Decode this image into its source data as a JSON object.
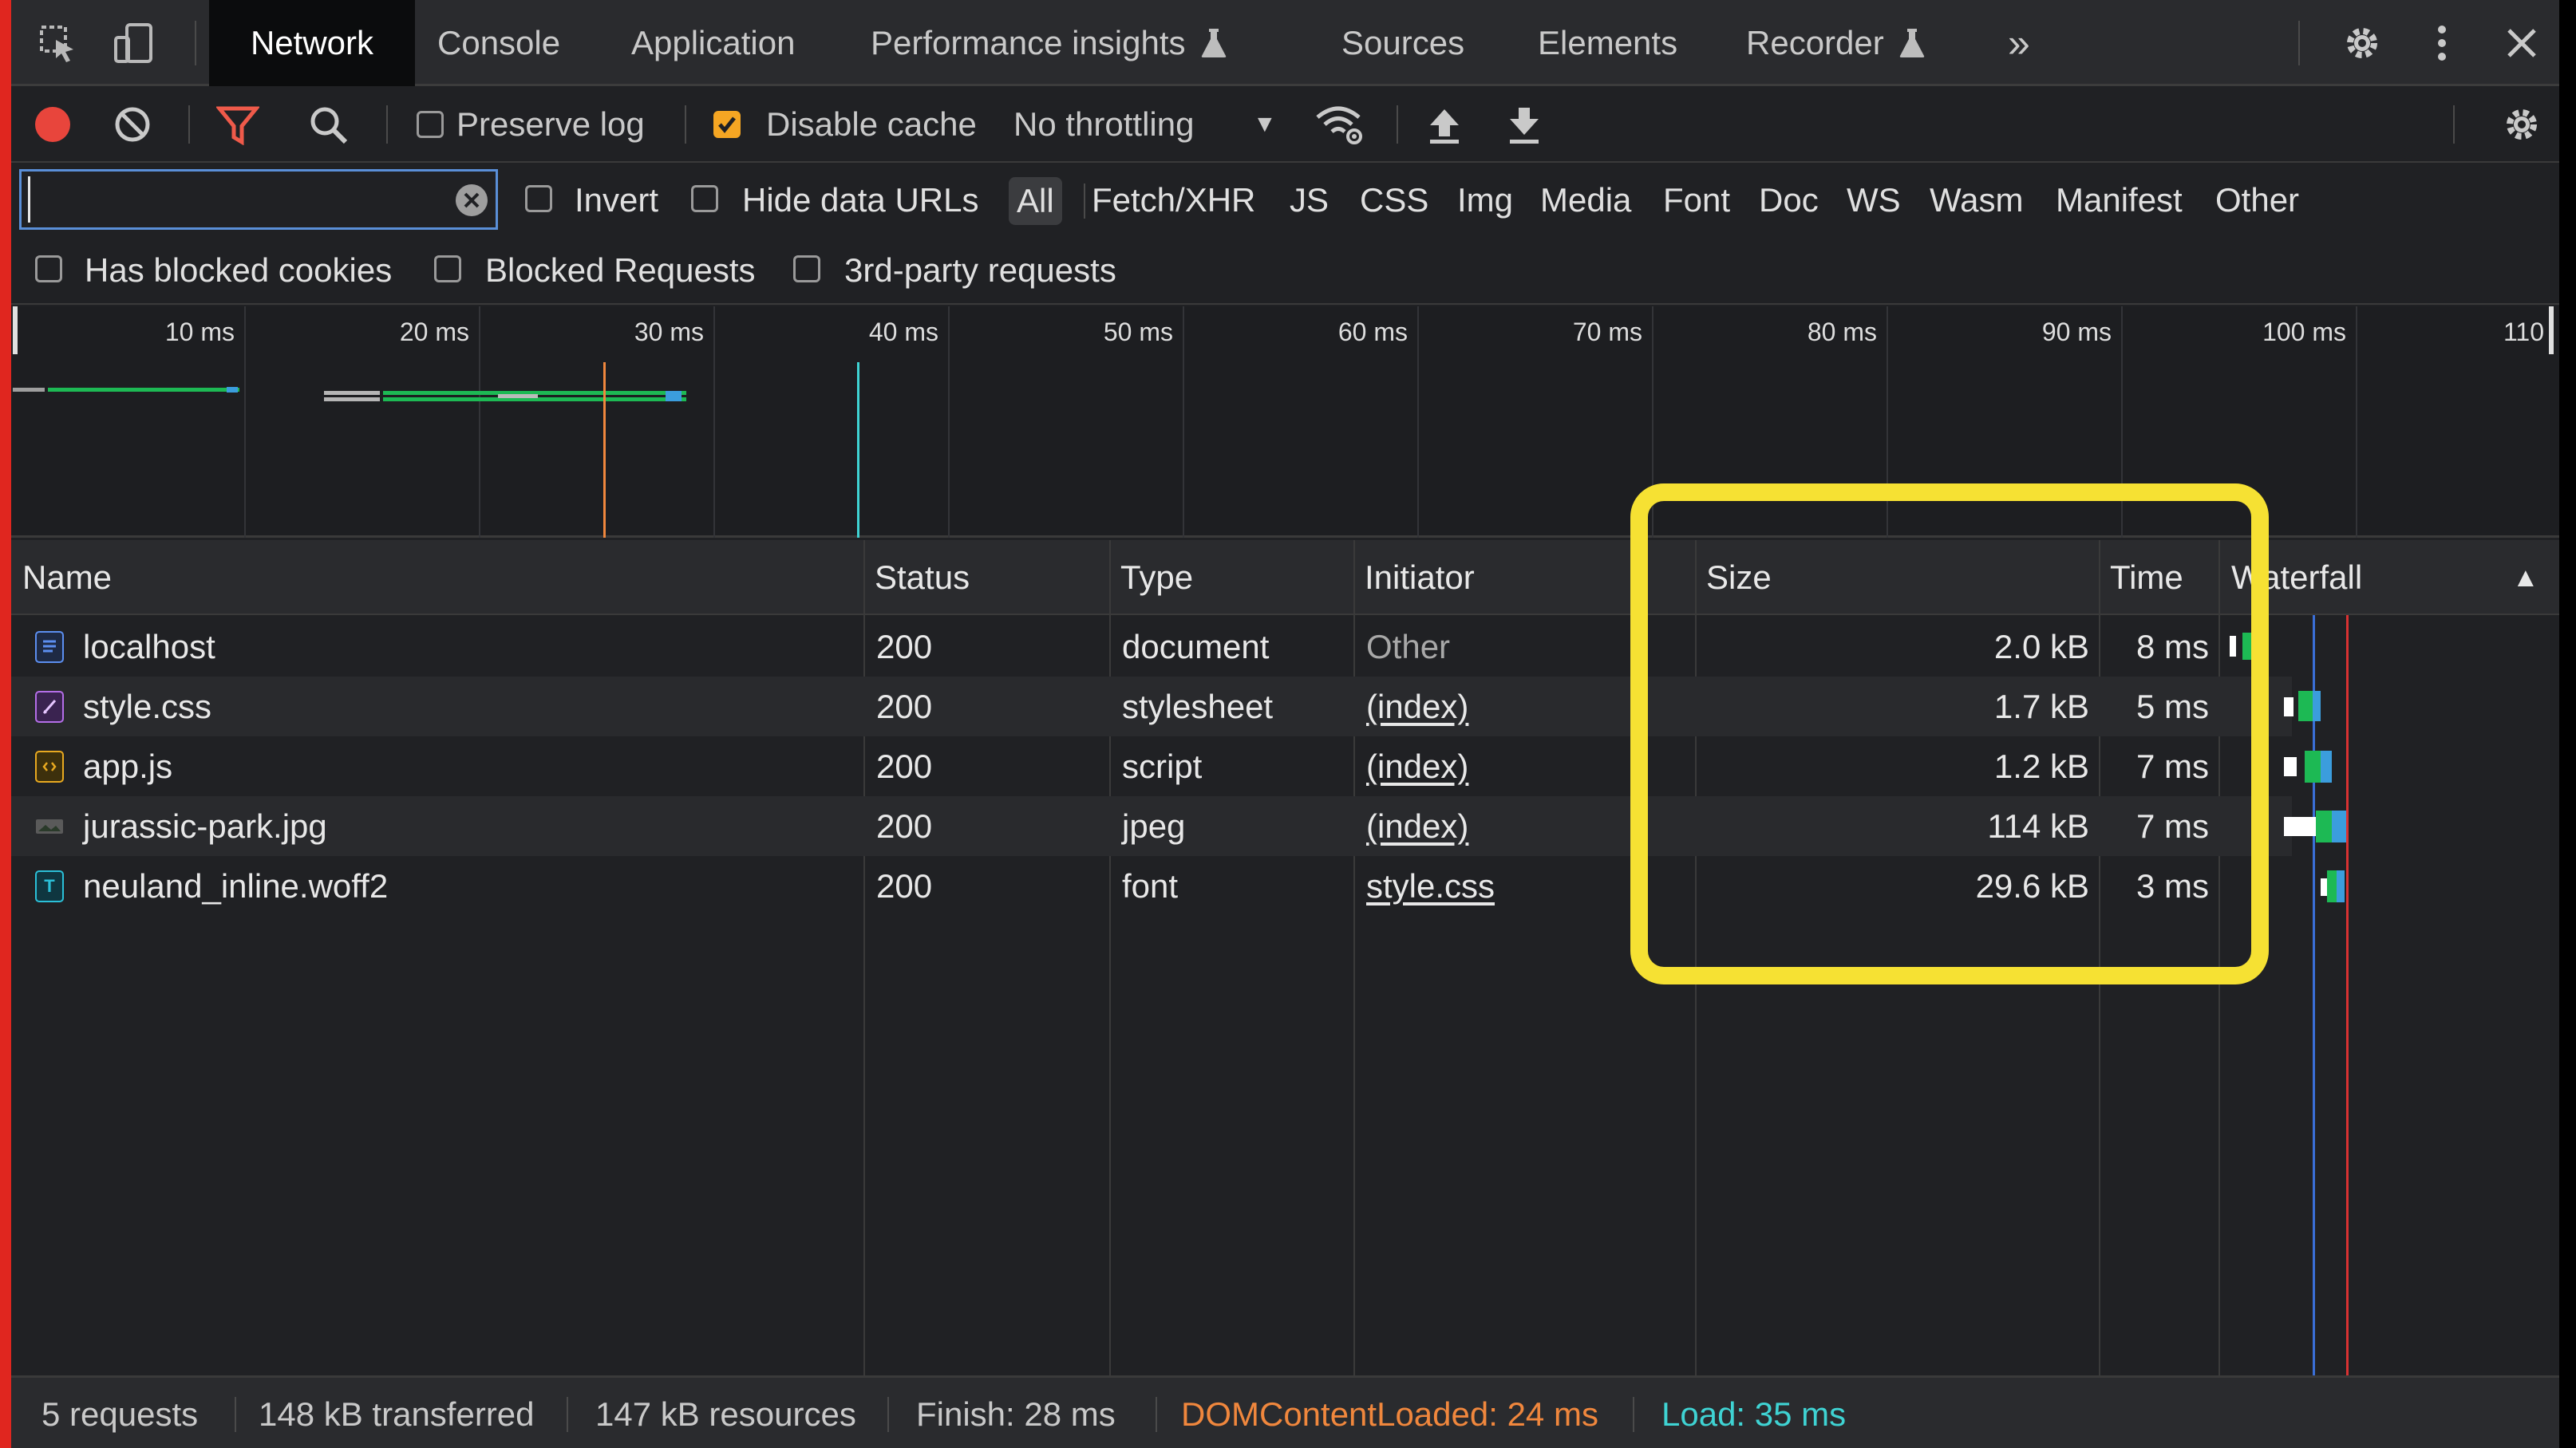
{
  "tabs": [
    {
      "label": "Network",
      "active": true
    },
    {
      "label": "Console"
    },
    {
      "label": "Application"
    },
    {
      "label": "Performance insights"
    },
    {
      "label": "Sources"
    },
    {
      "label": "Elements"
    },
    {
      "label": "Recorder"
    }
  ],
  "tabs_more": "»",
  "toolbar": {
    "preserve_log": "Preserve log",
    "disable_cache": "Disable cache",
    "throttling": "No throttling",
    "throttling_arrow": "▼"
  },
  "filter": {
    "placeholder": "",
    "invert": "Invert",
    "hide_data_urls": "Hide data URLs",
    "types": [
      "All",
      "Fetch/XHR",
      "JS",
      "CSS",
      "Img",
      "Media",
      "Font",
      "Doc",
      "WS",
      "Wasm",
      "Manifest",
      "Other"
    ],
    "has_blocked_cookies": "Has blocked cookies",
    "blocked_requests": "Blocked Requests",
    "third_party": "3rd-party requests"
  },
  "overview": {
    "ticks": [
      "10 ms",
      "20 ms",
      "30 ms",
      "40 ms",
      "50 ms",
      "60 ms",
      "70 ms",
      "80 ms",
      "90 ms",
      "100 ms",
      "110"
    ]
  },
  "table": {
    "headers": {
      "name": "Name",
      "status": "Status",
      "type": "Type",
      "initiator": "Initiator",
      "size": "Size",
      "time": "Time",
      "waterfall": "Waterfall",
      "sort_arrow": "▲"
    },
    "rows": [
      {
        "name": "localhost",
        "status": "200",
        "type": "document",
        "initiator": "Other",
        "size": "2.0 kB",
        "time": "8 ms",
        "icon": "document-icon"
      },
      {
        "name": "style.css",
        "status": "200",
        "type": "stylesheet",
        "initiator": "(index)",
        "size": "1.7 kB",
        "time": "5 ms",
        "icon": "stylesheet-icon"
      },
      {
        "name": "app.js",
        "status": "200",
        "type": "script",
        "initiator": "(index)",
        "size": "1.2 kB",
        "time": "7 ms",
        "icon": "script-icon"
      },
      {
        "name": "jurassic-park.jpg",
        "status": "200",
        "type": "jpeg",
        "initiator": "(index)",
        "size": "114 kB",
        "time": "7 ms",
        "icon": "image-icon"
      },
      {
        "name": "neuland_inline.woff2",
        "status": "200",
        "type": "font",
        "initiator": "style.css",
        "size": "29.6 kB",
        "time": "3 ms",
        "icon": "font-icon"
      }
    ]
  },
  "status": {
    "requests": "5 requests",
    "transferred": "148 kB transferred",
    "resources": "147 kB resources",
    "finish": "Finish: 28 ms",
    "dom_content_loaded": "DOMContentLoaded: 24 ms",
    "load": "Load: 35 ms"
  },
  "colors": {
    "highlight": "#f6e133",
    "record": "#e8453c",
    "dcl": "#f0873d",
    "load": "#3fd3d3",
    "checked": "#f5a623"
  }
}
